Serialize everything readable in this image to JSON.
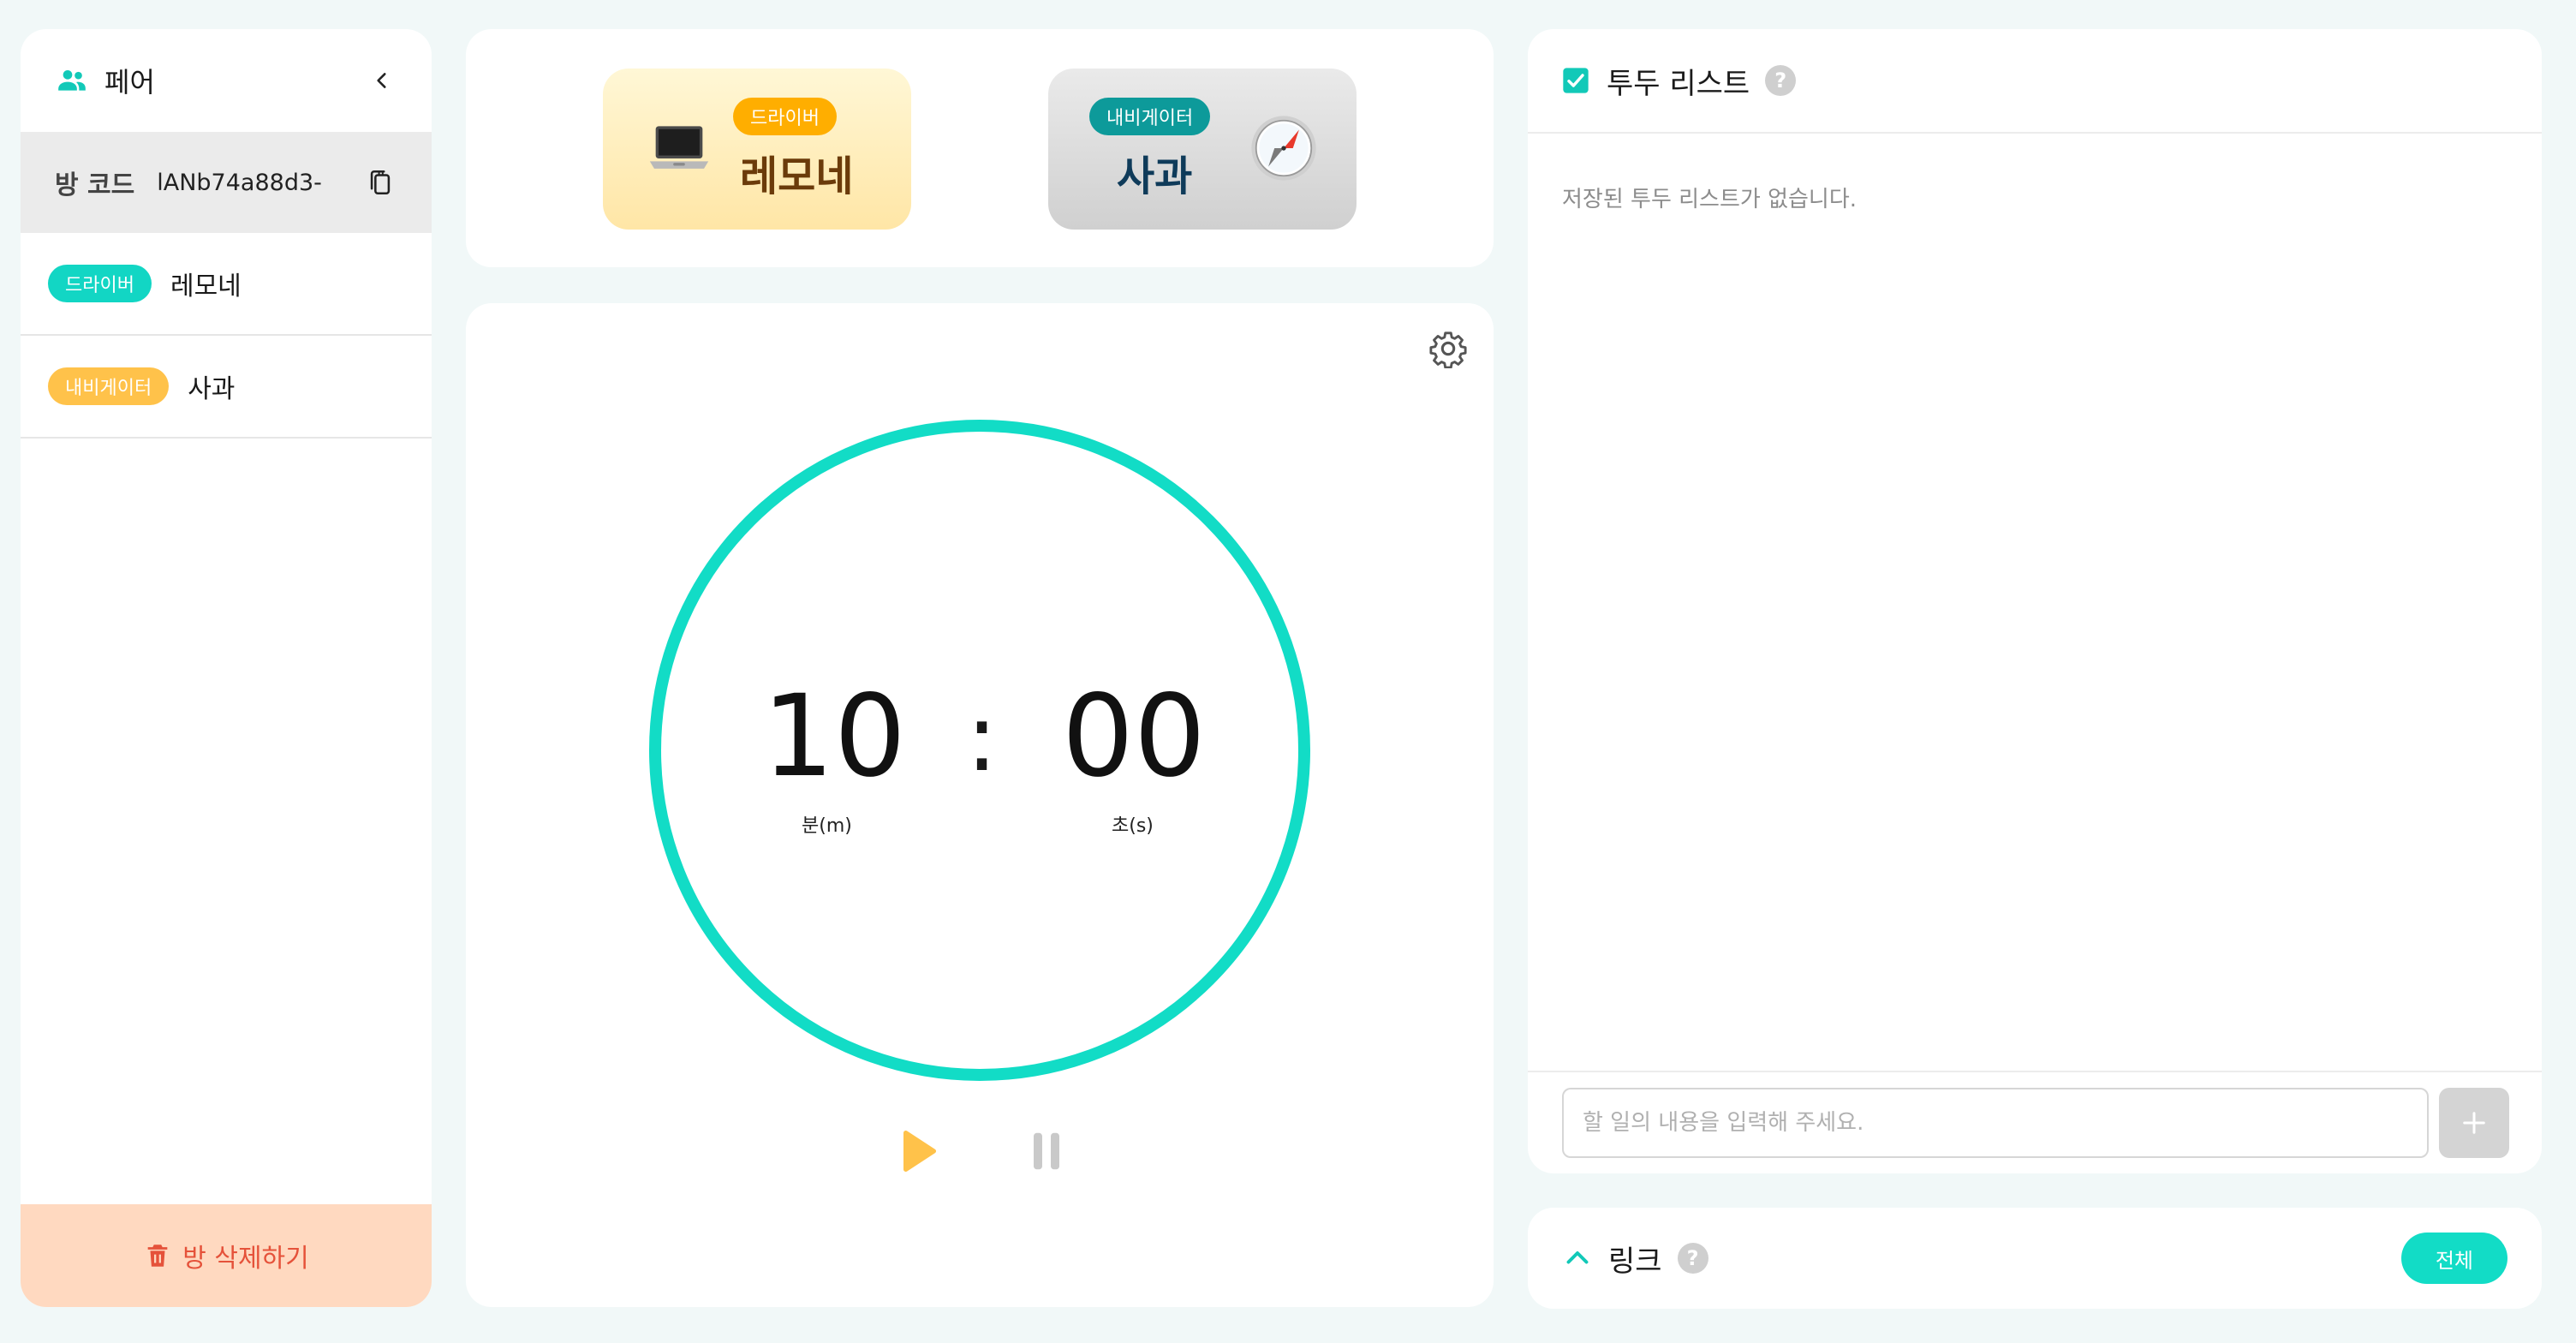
{
  "sidebar": {
    "title": "페어",
    "room_code_label": "방 코드",
    "room_code": "lANb74a88d3-",
    "members": [
      {
        "role": "드라이버",
        "name": "레모네",
        "role_color": "#12d6c4"
      },
      {
        "role": "내비게이터",
        "name": "사과",
        "role_color": "#ffc24a"
      }
    ],
    "delete_label": "방 삭제하기"
  },
  "roles": {
    "driver": {
      "badge": "드라이버",
      "name": "레모네",
      "icon": "laptop-icon"
    },
    "navigator": {
      "badge": "내비게이터",
      "name": "사과",
      "icon": "compass-icon"
    }
  },
  "timer": {
    "minutes": "10",
    "seconds": "00",
    "separator": ":",
    "minutes_unit": "분(m)",
    "seconds_unit": "초(s)",
    "ring_color": "#12dcc6",
    "play_color": "#ffc24a"
  },
  "todo": {
    "title": "투두 리스트",
    "help": "?",
    "empty_text": "저장된 투두 리스트가 없습니다.",
    "input_placeholder": "할 일의 내용을 입력해 주세요.",
    "input_value": "",
    "add_label": "+"
  },
  "links": {
    "title": "링크",
    "help": "?",
    "all_label": "전체"
  }
}
